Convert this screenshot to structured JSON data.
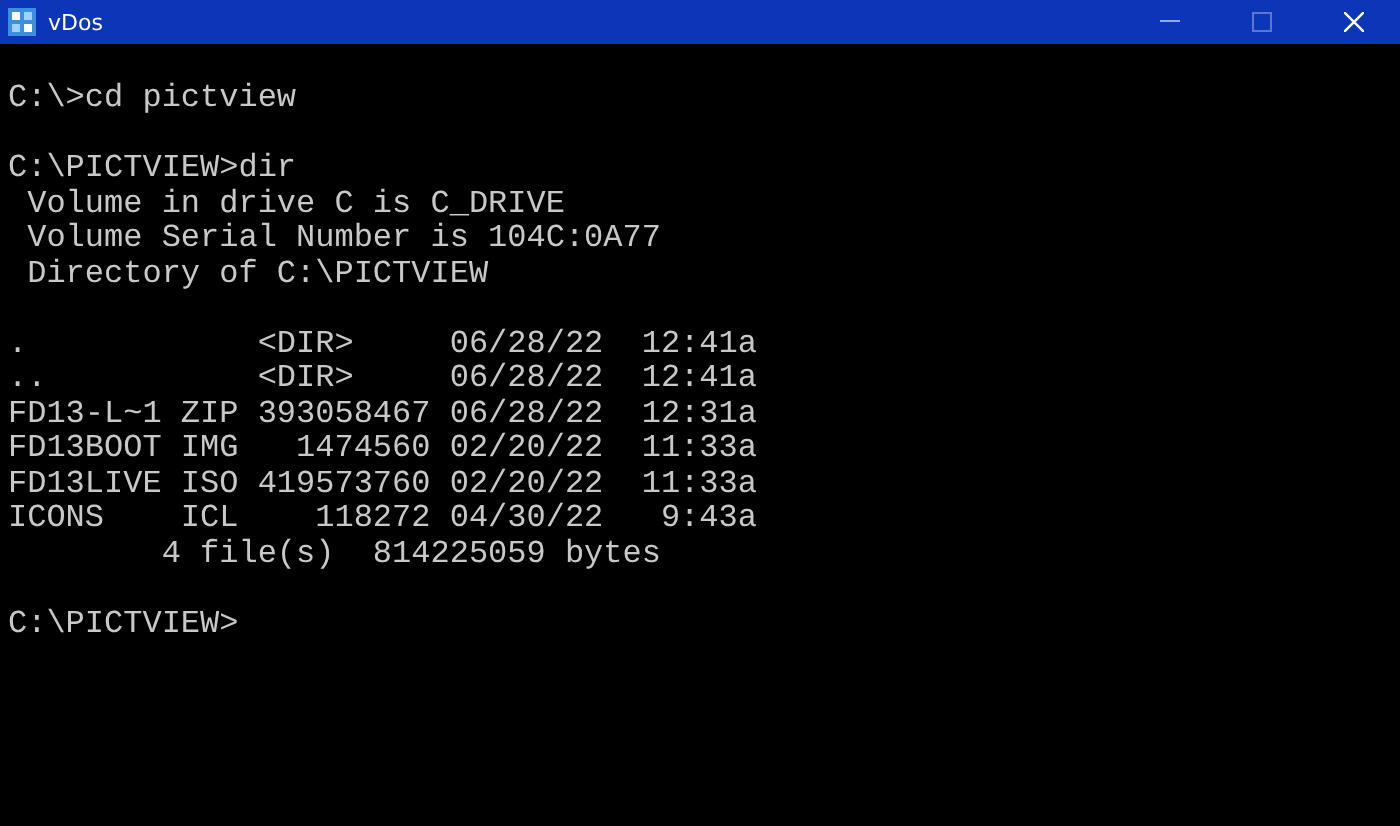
{
  "window": {
    "title": "vDos"
  },
  "console": {
    "blocks": [
      [
        "C:\\>cd pictview"
      ],
      [
        "C:\\PICTVIEW>dir",
        " Volume in drive C is C_DRIVE",
        " Volume Serial Number is 104C:0A77",
        " Directory of C:\\PICTVIEW"
      ],
      [
        ".            <DIR>     06/28/22  12:41a",
        "..           <DIR>     06/28/22  12:41a",
        "FD13-L~1 ZIP 393058467 06/28/22  12:31a",
        "FD13BOOT IMG   1474560 02/20/22  11:33a",
        "FD13LIVE ISO 419573760 02/20/22  11:33a",
        "ICONS    ICL    118272 04/30/22   9:43a",
        "        4 file(s)  814225059 bytes"
      ],
      [
        "C:\\PICTVIEW>"
      ]
    ]
  }
}
